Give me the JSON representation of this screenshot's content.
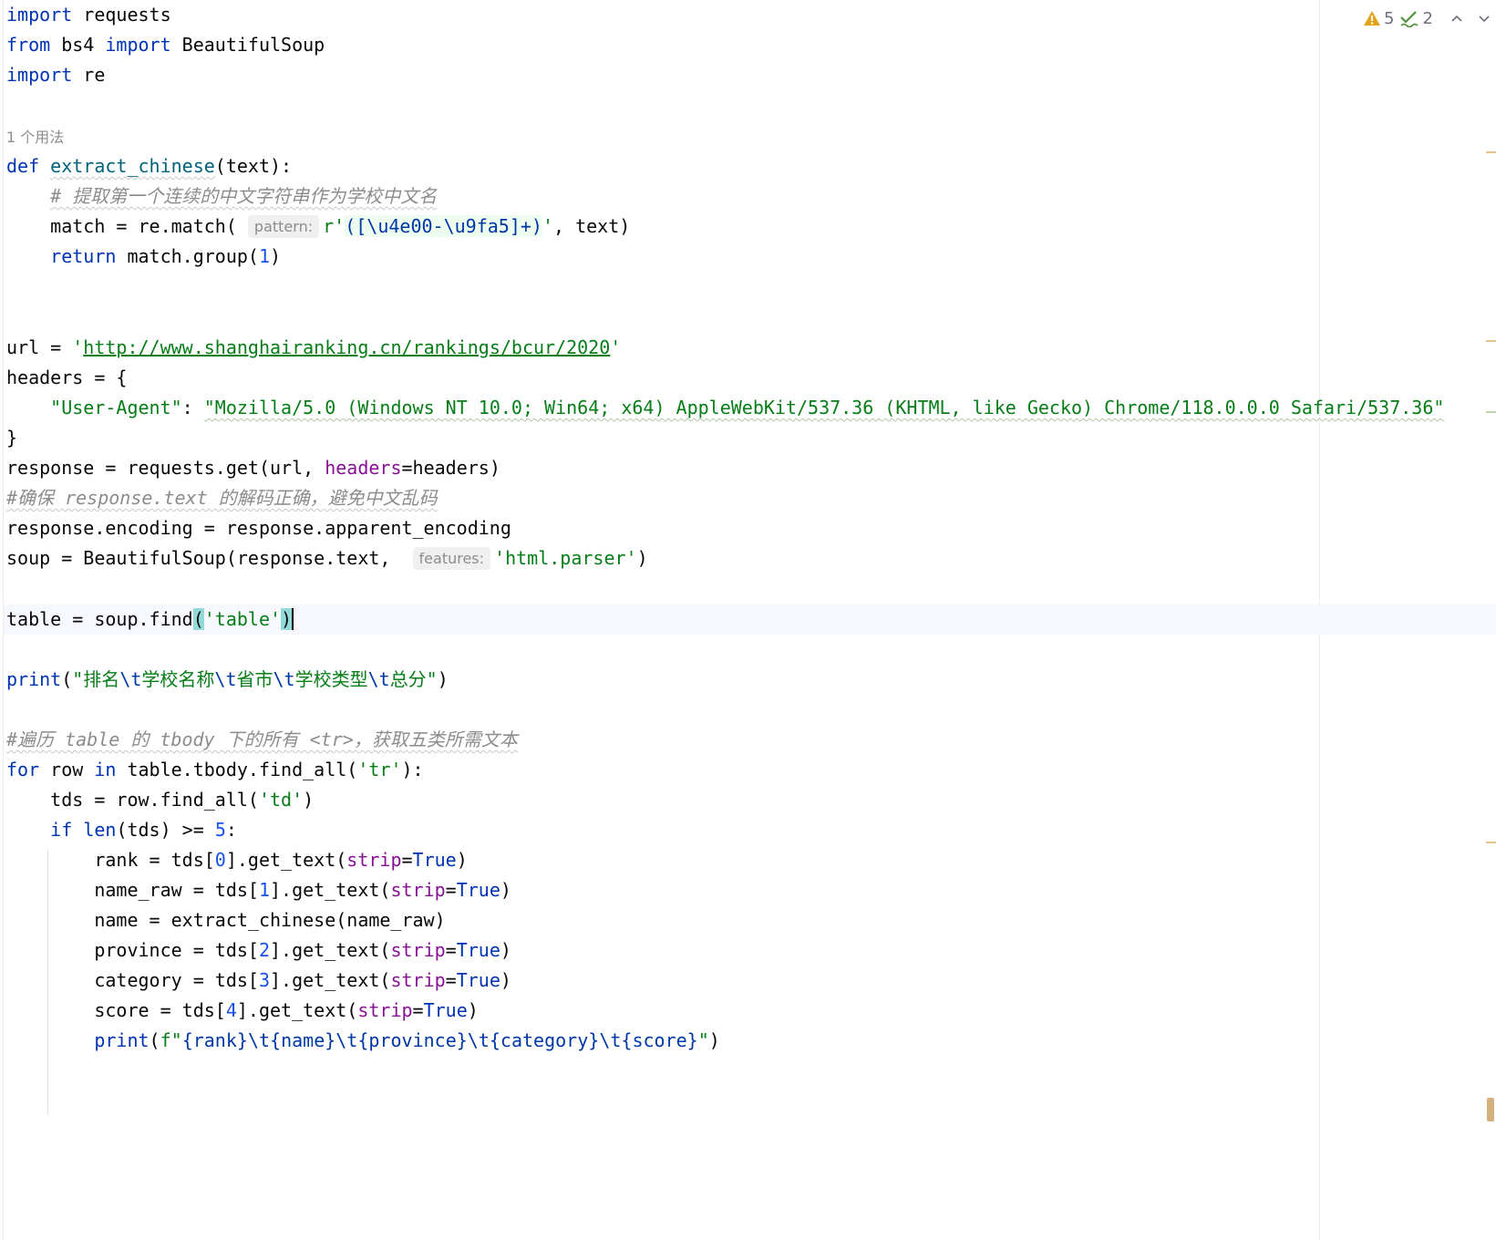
{
  "inspections": {
    "warnings": "5",
    "typos": "2"
  },
  "code": {
    "l1": {
      "kw": "import",
      "rest": " requests"
    },
    "l2": {
      "kw1": "from",
      "mid": " bs4 ",
      "kw2": "import",
      "rest": " BeautifulSoup"
    },
    "l3": {
      "kw": "import",
      "rest": " re"
    },
    "usage_hint": "1 个用法",
    "l5": {
      "kw": "def",
      "fn": "extract_chinese",
      "rest": "(text):"
    },
    "l6": {
      "comment": "# 提取第一个连续的中文字符串作为学校中文名"
    },
    "l7": {
      "a": "match = re.match(",
      "hint": "pattern:",
      "b": "r'",
      "c": "([\\u4e00-\\u9fa5]+)",
      "d": "'",
      "e": ", text)"
    },
    "l8": {
      "kw": "return",
      "a": " match.group(",
      "num": "1",
      "b": ")"
    },
    "l11": {
      "a": "url = ",
      "q1": "'",
      "url": "http://www.shanghairanking.cn/rankings/bcur/2020",
      "q2": "'"
    },
    "l12": {
      "text": "headers = {"
    },
    "l13": {
      "key": "\"User-Agent\"",
      "colon": ": ",
      "value": "\"Mozilla/5.0 (Windows NT 10.0; Win64; x64) AppleWebKit/537.36 (KHTML, like Gecko) Chrome/118.0.0.0 Safari/537.36\""
    },
    "l14": {
      "text": "}"
    },
    "l15": {
      "a": "response = requests.get(url, ",
      "param": "headers",
      "b": "=headers)"
    },
    "l16": {
      "comment": "#确保 response.text 的解码正确，避免中文乱码"
    },
    "l17": {
      "text": "response.encoding = response.apparent_encoding"
    },
    "l18": {
      "a": "soup = BeautifulSoup(response.text, ",
      "hint": "features:",
      "str": "'html.parser'",
      "b": ")"
    },
    "l20": {
      "a": "table = soup.find",
      "p1": "(",
      "str": "'table'",
      "p2": ")"
    },
    "l22": {
      "fn": "print",
      "a": "(",
      "s1": "\"排名",
      "e1": "\\t",
      "s2": "学校名称",
      "e2": "\\t",
      "s3": "省市",
      "e3": "\\t",
      "s4": "学校类型",
      "e4": "\\t",
      "s5": "总分\"",
      "b": ")"
    },
    "l24": {
      "comment": "#遍历 table 的 tbody 下的所有 <tr>，获取五类所需文本"
    },
    "l25": {
      "kw1": "for",
      "a": " row ",
      "kw2": "in",
      "b": " table.tbody.find_all(",
      "str": "'tr'",
      "c": "):"
    },
    "l26": {
      "a": "tds = row.find_all(",
      "str": "'td'",
      "b": ")"
    },
    "l27": {
      "kw": "if",
      "sp": " ",
      "fn": "len",
      "a": "(tds) >= ",
      "num": "5",
      "b": ":"
    },
    "l28": {
      "a": "rank = tds[",
      "num": "0",
      "b": "].get_text(",
      "param": "strip",
      "eq": "=",
      "kw": "True",
      "c": ")"
    },
    "l29": {
      "a": "name_raw = tds[",
      "num": "1",
      "b": "].get_text(",
      "param": "strip",
      "eq": "=",
      "kw": "True",
      "c": ")"
    },
    "l30": {
      "text": "name = extract_chinese(name_raw)"
    },
    "l31": {
      "a": "province = tds[",
      "num": "2",
      "b": "].get_text(",
      "param": "strip",
      "eq": "=",
      "kw": "True",
      "c": ")"
    },
    "l32": {
      "a": "category = tds[",
      "num": "3",
      "b": "].get_text(",
      "param": "strip",
      "eq": "=",
      "kw": "True",
      "c": ")"
    },
    "l33": {
      "a": "score = tds[",
      "num": "4",
      "b": "].get_text(",
      "param": "strip",
      "eq": "=",
      "kw": "True",
      "c": ")"
    },
    "l34": {
      "fn": "print",
      "a": "(",
      "s1": "f\"",
      "v1": "{rank}",
      "e1": "\\t",
      "v2": "{name}",
      "e2": "\\t",
      "v3": "{province}",
      "e3": "\\t",
      "v4": "{category}",
      "e4": "\\t",
      "v5": "{score}",
      "s2": "\"",
      "b": ")"
    }
  },
  "colors": {
    "keyword": "#0033b3",
    "function": "#00627a",
    "string": "#067d17",
    "number": "#1750eb",
    "comment": "#8c8c8c",
    "parameter": "#871094",
    "caret_row": "#f6f8fe",
    "warning": "#e4a31c",
    "typo": "#4d8f3a"
  },
  "icons": [
    "warning-icon",
    "typo-check-icon",
    "chevron-up-icon",
    "chevron-down-icon"
  ]
}
